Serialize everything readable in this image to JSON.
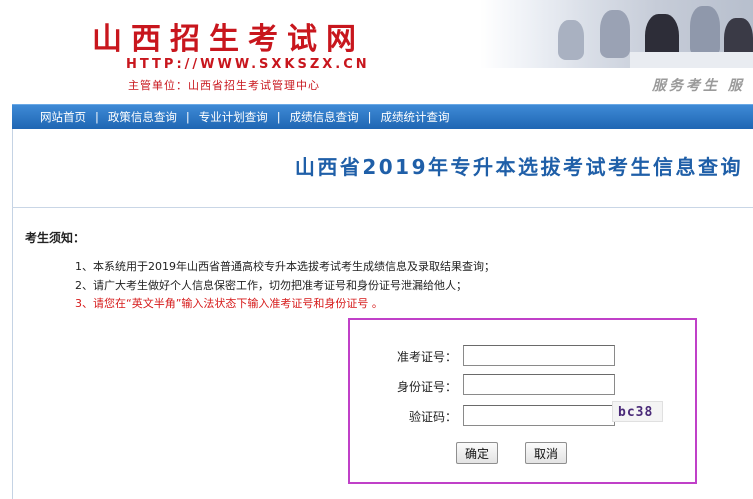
{
  "header": {
    "site_title": "山西招生考试网",
    "site_url": "HTTP://WWW.SXKSZX.CN",
    "sponsor": "主管单位：山西省招生考试管理中心",
    "slogan": "服务考生 服"
  },
  "nav": {
    "items": [
      {
        "label": "网站首页"
      },
      {
        "label": "政策信息查询"
      },
      {
        "label": "专业计划查询"
      },
      {
        "label": "成绩信息查询"
      },
      {
        "label": "成绩统计查询"
      }
    ],
    "separator": "|"
  },
  "page": {
    "title": "山西省2019年专升本选拔考试考生信息查询"
  },
  "notice": {
    "heading": "考生须知：",
    "items": [
      "1、本系统用于2019年山西省普通高校专升本选拔考试考生成绩信息及录取结果查询；",
      "2、请广大考生做好个人信息保密工作，切勿把准考证号和身份证号泄漏给他人；",
      "3、请您在“英文半角”输入法状态下输入准考证号和身份证号 。"
    ],
    "warning_color": "#d61a1a"
  },
  "form": {
    "exam_id_label": "准考证号：",
    "id_card_label": "身份证号：",
    "captcha_label": "验证码：",
    "exam_id_value": "",
    "id_card_value": "",
    "captcha_value": "",
    "captcha_image_text": "bc38",
    "submit_label": "确定",
    "cancel_label": "取消",
    "highlight_color": "#c040c8"
  }
}
